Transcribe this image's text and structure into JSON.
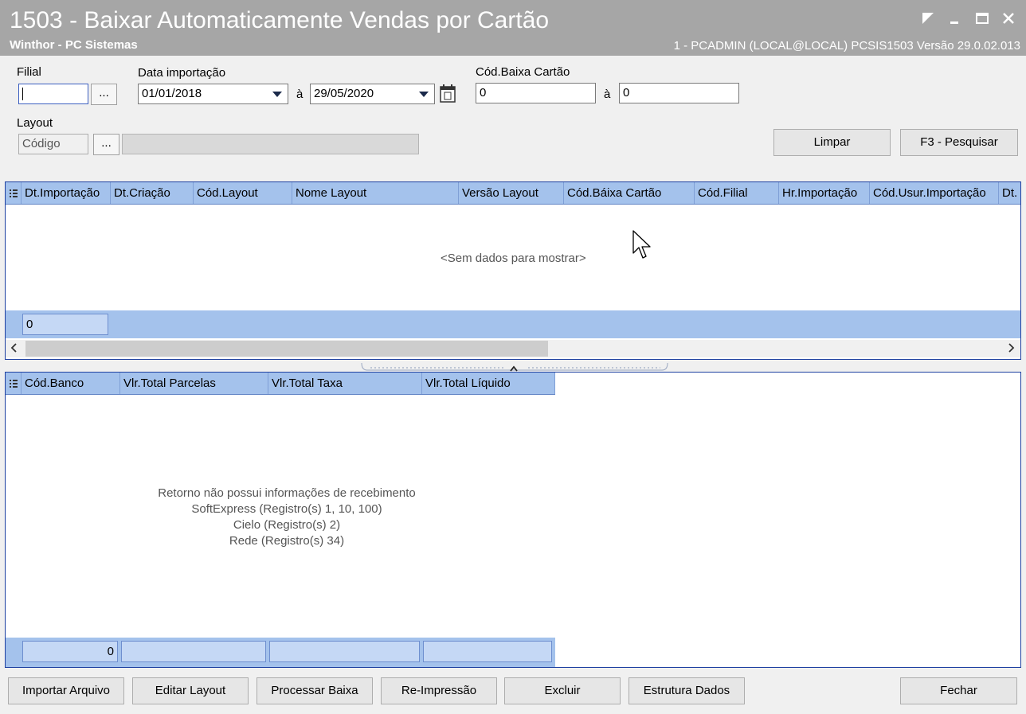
{
  "window": {
    "title": "1503 - Baixar Automaticamente Vendas por Cartão",
    "subtitle": "Winthor - PC Sistemas",
    "userinfo": "1 - PCADMIN (LOCAL@LOCAL)   PCSIS1503  Versão  29.0.02.013",
    "colors": {
      "titlebar": "#a6a6a6",
      "grid_header": "#a4c2ec",
      "grid_border": "#1c3fa0"
    }
  },
  "filters": {
    "filial_label": "Filial",
    "filial_value": "",
    "dots": "...",
    "data_label": "Data importação",
    "data_from": "01/01/2018",
    "a": "à",
    "data_to": "29/05/2020",
    "cod_baixa_label": "Cód.Baixa Cartão",
    "cod_baixa_from": "0",
    "cod_baixa_to": "0",
    "layout_label": "Layout",
    "layout_placeholder": "Código",
    "layout_desc": ""
  },
  "actions": {
    "limpar": "Limpar",
    "pesquisar": "F3 - Pesquisar"
  },
  "grid1": {
    "columns": [
      "Dt.Importação",
      "Dt.Criação",
      "Cód.Layout",
      "Nome Layout",
      "Versão Layout",
      "Cód.Báixa Cartão",
      "Cód.Filial",
      "Hr.Importação",
      "Cód.Usur.Importação",
      "Dt."
    ],
    "empty_text": "<Sem dados para mostrar>",
    "footer_count": "0"
  },
  "grid2": {
    "columns": [
      "Cód.Banco",
      "Vlr.Total Parcelas",
      "Vlr.Total Taxa",
      "Vlr.Total Líquido"
    ],
    "empty_lines": [
      "Retorno não possui informações de recebimento",
      "SoftExpress (Registro(s) 1, 10, 100)",
      "Cielo (Registro(s) 2)",
      "Rede (Registro(s) 34)"
    ],
    "footer": [
      "0",
      "",
      "",
      ""
    ]
  },
  "bottom_buttons": {
    "importar": "Importar Arquivo",
    "editar": "Editar Layout",
    "processar": "Processar Baixa",
    "reimpressao": "Re-Impressão",
    "excluir": "Excluir",
    "estrutura": "Estrutura Dados",
    "fechar": "Fechar"
  }
}
